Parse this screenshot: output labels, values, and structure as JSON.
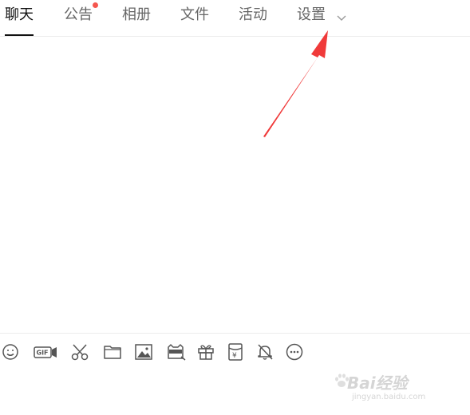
{
  "tabs": [
    {
      "label": "聊天",
      "active": true
    },
    {
      "label": "公告",
      "has_badge": true
    },
    {
      "label": "相册"
    },
    {
      "label": "文件"
    },
    {
      "label": "活动"
    },
    {
      "label": "设置",
      "has_dropdown": true
    }
  ],
  "colors": {
    "badge": "#f5564e",
    "arrow": "#f03a3a",
    "active_tab": "#111111",
    "tab_text": "#666666",
    "icon": "#555555"
  },
  "toolbar": {
    "icons": [
      "emoji-icon",
      "gif-icon",
      "scissors-icon",
      "folder-icon",
      "image-icon",
      "avatar-mask-icon",
      "gift-icon",
      "red-packet-icon",
      "bell-off-icon",
      "more-icon"
    ],
    "gif_label": "GIF",
    "yen_label": "¥"
  },
  "watermark": {
    "brand": "Bai经验",
    "url": "jingyan.baidu.com"
  }
}
